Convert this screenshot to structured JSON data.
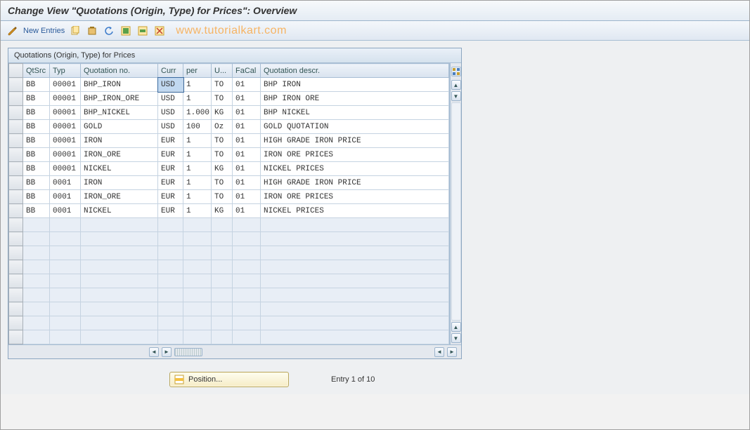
{
  "title": "Change View \"Quotations (Origin, Type) for Prices\": Overview",
  "toolbar": {
    "new_entries": "New Entries",
    "watermark": "www.tutorialkart.com"
  },
  "panel": {
    "heading": "Quotations (Origin, Type) for Prices",
    "columns": [
      "QtSrc",
      "Typ",
      "Quotation no.",
      "Curr",
      "per",
      "U...",
      "FaCal",
      "Quotation descr."
    ],
    "rows": [
      {
        "qtsrc": "BB",
        "typ": "00001",
        "qno": "BHP_IRON",
        "curr": "USD",
        "per": "1",
        "uom": "TO",
        "facal": "01",
        "descr": "BHP IRON"
      },
      {
        "qtsrc": "BB",
        "typ": "00001",
        "qno": "BHP_IRON_ORE",
        "curr": "USD",
        "per": "1",
        "uom": "TO",
        "facal": "01",
        "descr": "BHP IRON ORE"
      },
      {
        "qtsrc": "BB",
        "typ": "00001",
        "qno": "BHP_NICKEL",
        "curr": "USD",
        "per": "1.000",
        "uom": "KG",
        "facal": "01",
        "descr": "BHP NICKEL"
      },
      {
        "qtsrc": "BB",
        "typ": "00001",
        "qno": "GOLD",
        "curr": "USD",
        "per": "100",
        "uom": "Oz",
        "facal": "01",
        "descr": "GOLD QUOTATION"
      },
      {
        "qtsrc": "BB",
        "typ": "00001",
        "qno": "IRON",
        "curr": "EUR",
        "per": "1",
        "uom": "TO",
        "facal": "01",
        "descr": "HIGH GRADE IRON PRICE"
      },
      {
        "qtsrc": "BB",
        "typ": "00001",
        "qno": "IRON_ORE",
        "curr": "EUR",
        "per": "1",
        "uom": "TO",
        "facal": "01",
        "descr": "IRON ORE PRICES"
      },
      {
        "qtsrc": "BB",
        "typ": "00001",
        "qno": "NICKEL",
        "curr": "EUR",
        "per": "1",
        "uom": "KG",
        "facal": "01",
        "descr": "NICKEL PRICES"
      },
      {
        "qtsrc": "BB",
        "typ": "0001",
        "qno": "IRON",
        "curr": "EUR",
        "per": "1",
        "uom": "TO",
        "facal": "01",
        "descr": "HIGH GRADE IRON PRICE"
      },
      {
        "qtsrc": "BB",
        "typ": "0001",
        "qno": "IRON_ORE",
        "curr": "EUR",
        "per": "1",
        "uom": "TO",
        "facal": "01",
        "descr": "IRON ORE PRICES"
      },
      {
        "qtsrc": "BB",
        "typ": "0001",
        "qno": "NICKEL",
        "curr": "EUR",
        "per": "1",
        "uom": "KG",
        "facal": "01",
        "descr": "NICKEL PRICES"
      }
    ],
    "empty_rows": 9,
    "selected_cell": {
      "row": 0,
      "col": "curr"
    }
  },
  "footer": {
    "position_label": "Position...",
    "entry_text": "Entry 1 of 10"
  }
}
